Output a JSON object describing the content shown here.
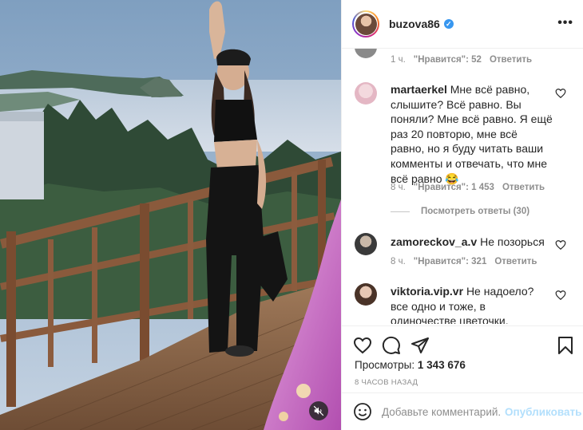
{
  "post": {
    "username": "buzova86",
    "more_icon": "more-horizontal-icon"
  },
  "comments": {
    "first_partial": {
      "time": "1 ч.",
      "likes": "\"Нравится\": 52",
      "reply": "Ответить"
    },
    "items": [
      {
        "username": "martaerkel",
        "text": "Мне всё равно, слышите? Всё равно. Вы поняли? Мне всё равно. Я ещё раз 20 повторю, мне всё равно, но я буду читать ваши комменты и отвечать, что мне всё равно 😂",
        "time": "8 ч.",
        "likes": "\"Нравится\": 1 453",
        "reply": "Ответить",
        "view_replies": "Посмотреть ответы (30)"
      },
      {
        "username": "zamoreckov_a.v",
        "text": "Не позорься",
        "time": "8 ч.",
        "likes": "\"Нравится\": 321",
        "reply": "Ответить"
      },
      {
        "username": "viktoria.vip.vr",
        "text": "Не надоело? все одно и тоже, в одиночестве цветочки, песенки, делать вид"
      }
    ]
  },
  "stats": {
    "views_label": "Просмотры:",
    "views_value": "1 343 676",
    "posted_ago": "8 ЧАСОВ НАЗАД"
  },
  "add_comment": {
    "placeholder": "Добавьте комментарий...",
    "publish_label": "Опубликовать"
  },
  "colors": {
    "accent": "#0095f6",
    "publish_disabled": "#b2dffc",
    "muted_text": "#8e8e8e",
    "verified": "#3897f0"
  }
}
